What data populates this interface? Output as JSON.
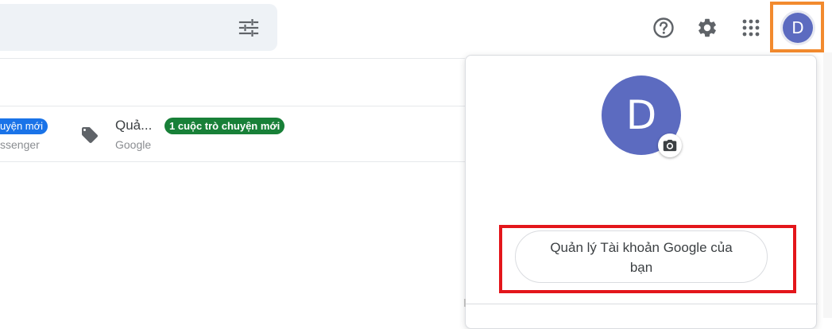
{
  "header": {
    "icons": {
      "filter": "tune-icon",
      "help": "help-icon",
      "settings": "gear-icon",
      "apps": "apps-grid-icon"
    },
    "avatar_letter": "D"
  },
  "mail_list": {
    "rows": [
      {
        "badge": "uyện mới",
        "subtitle": "ssenger"
      },
      {
        "icon": "label-tag-icon",
        "sender": "Quả...",
        "badge": "1 cuộc trò chuyện mới",
        "subtitle": "Google"
      }
    ]
  },
  "account_panel": {
    "avatar_letter": "D",
    "camera_icon": "camera-icon",
    "manage_button_line1": "Quản lý Tài khoản Google của",
    "manage_button_line2": "bạn"
  },
  "colors": {
    "avatar": "#5c6bc0",
    "blue_badge": "#1a73e8",
    "green_badge": "#188038",
    "highlight_orange": "#f28a2e",
    "highlight_red": "#e3161b"
  }
}
